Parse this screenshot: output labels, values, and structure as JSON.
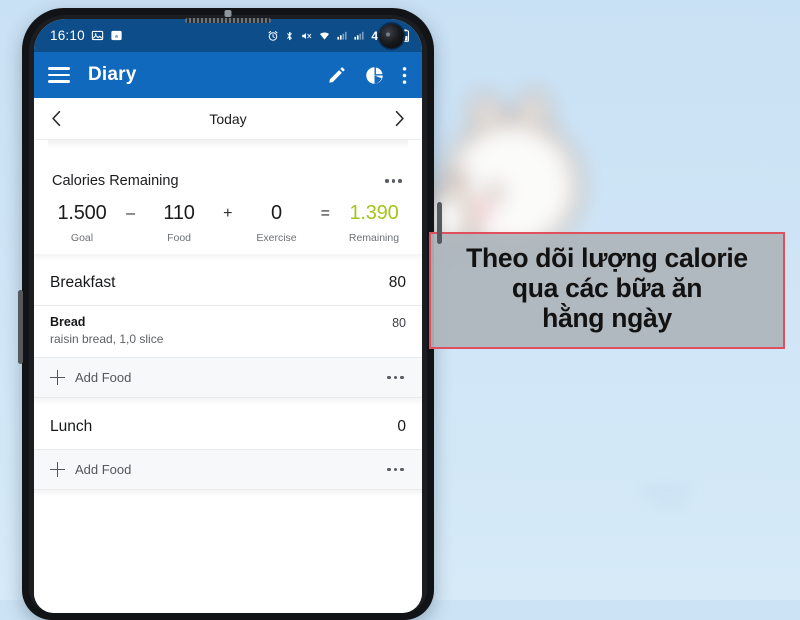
{
  "statusbar": {
    "time": "16:10",
    "battery_percent": "47%",
    "icons": [
      "image-icon",
      "app-notification-icon",
      "alarm-icon",
      "bluetooth-icon",
      "mute-icon",
      "wifi-icon",
      "signal-icon",
      "signal-icon-2",
      "battery-icon"
    ]
  },
  "appbar": {
    "title": "Diary",
    "menu_icon": "hamburger-icon",
    "edit_icon": "pencil-icon",
    "chart_icon": "pie-chart-icon",
    "overflow_icon": "more-vertical-icon"
  },
  "datenav": {
    "prev_icon": "chevron-left-icon",
    "label": "Today",
    "next_icon": "chevron-right-icon"
  },
  "calories": {
    "title": "Calories Remaining",
    "overflow_icon": "more-horizontal-icon",
    "items": [
      {
        "value": "1.500",
        "label": "Goal"
      },
      {
        "value": "110",
        "label": "Food"
      },
      {
        "value": "0",
        "label": "Exercise"
      },
      {
        "value": "1.390",
        "label": "Remaining"
      }
    ],
    "operators": [
      "–",
      "+",
      "="
    ],
    "remaining_color": "#a2c61c"
  },
  "meals": [
    {
      "name": "Breakfast",
      "calories": "80",
      "foods": [
        {
          "name": "Bread",
          "description": "raisin bread, 1,0 slice",
          "calories": "80"
        }
      ],
      "add_food_label": "Add Food"
    },
    {
      "name": "Lunch",
      "calories": "0",
      "foods": [],
      "add_food_label": "Add Food"
    }
  ],
  "caption": {
    "text": "Theo dõi lượng calorie\nqua các bữa ăn\nhằng ngày",
    "border_color": "#e0505c",
    "background_color": "#adb5bb"
  },
  "theme": {
    "statusbar_color": "#0c4d8a",
    "appbar_color": "#1169bd",
    "page_background": "#cce3f5"
  }
}
